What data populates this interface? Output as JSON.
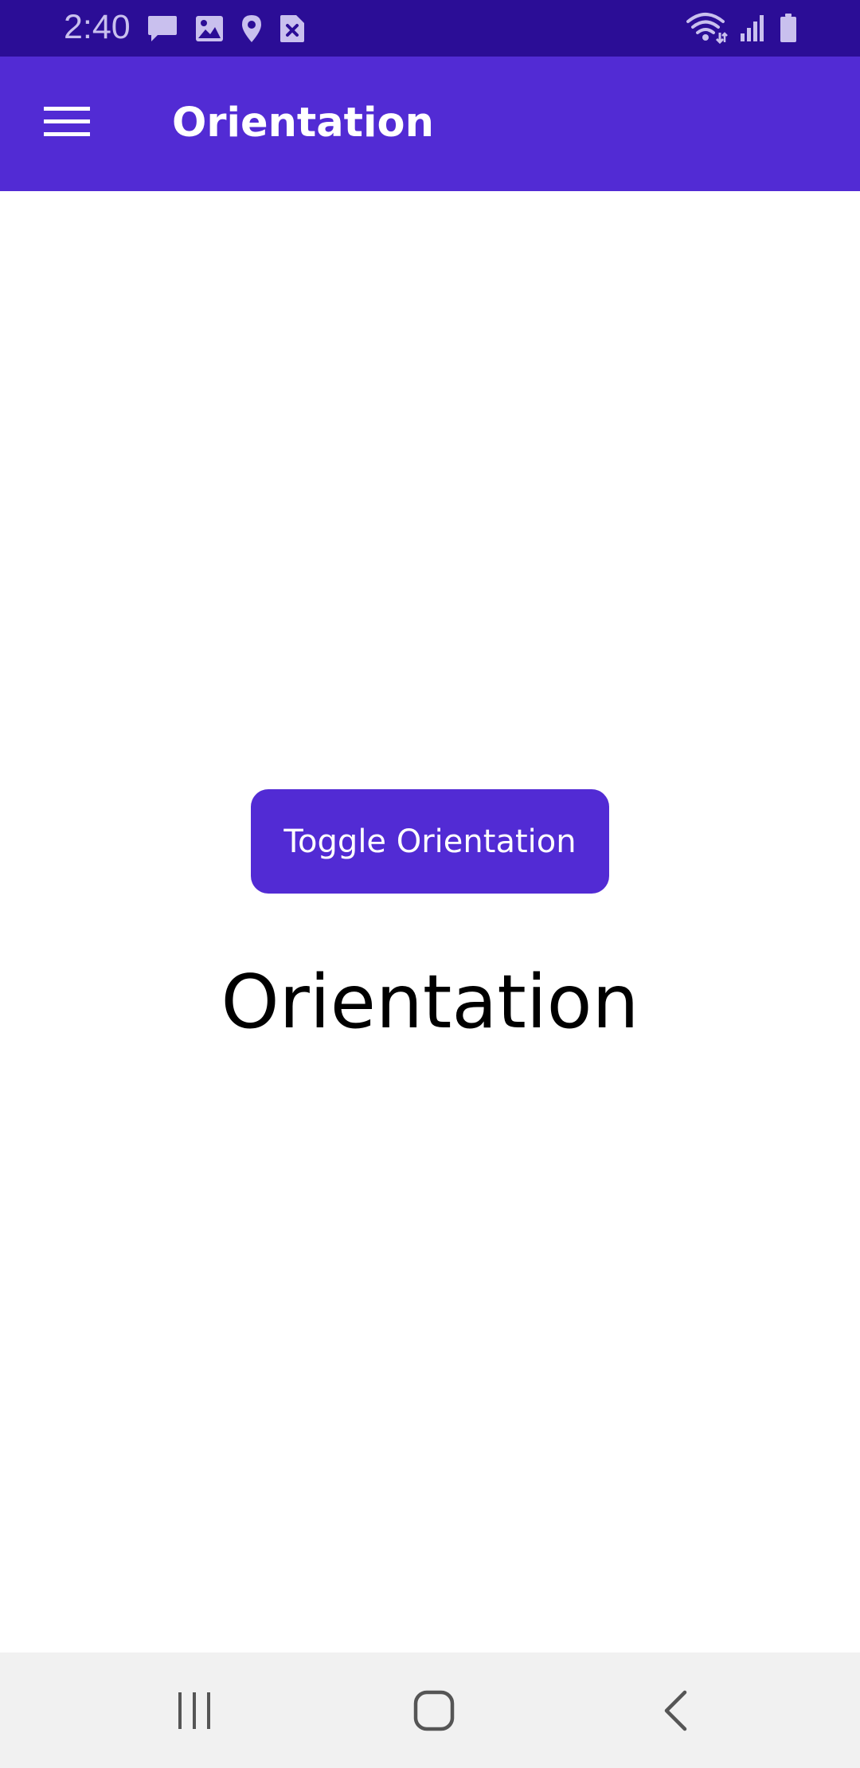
{
  "status_bar": {
    "time": "2:40",
    "left_icons": [
      "message-icon",
      "image-icon",
      "location-pin-icon",
      "download-error-icon"
    ],
    "right_icons": [
      "wifi-icon",
      "signal-icon",
      "battery-icon"
    ],
    "background": "#2b0d96"
  },
  "app_bar": {
    "title": "Orientation",
    "menu_icon": "hamburger-menu-icon",
    "background": "#522bd4"
  },
  "main": {
    "toggle_button_label": "Toggle Orientation",
    "orientation_text": "Orientation"
  },
  "nav_bar": {
    "buttons": [
      "recents-icon",
      "home-icon",
      "back-icon"
    ]
  }
}
